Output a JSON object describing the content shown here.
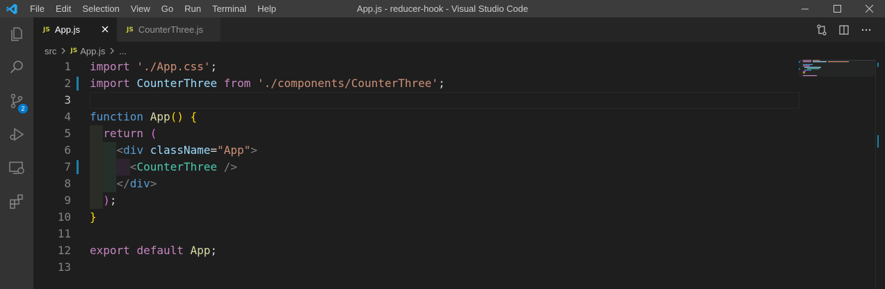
{
  "window": {
    "title": "App.js - reducer-hook - Visual Studio Code",
    "menu": [
      "File",
      "Edit",
      "Selection",
      "View",
      "Go",
      "Run",
      "Terminal",
      "Help"
    ]
  },
  "activity": {
    "scm_badge": "2"
  },
  "tabs": [
    {
      "label": "App.js",
      "icon": "JS",
      "active": true
    },
    {
      "label": "CounterThree.js",
      "icon": "JS",
      "active": false
    }
  ],
  "breadcrumb": {
    "folder": "src",
    "file_icon": "JS",
    "file": "App.js",
    "symbol": "..."
  },
  "editor": {
    "line_numbers": [
      "1",
      "2",
      "3",
      "4",
      "5",
      "6",
      "7",
      "8",
      "9",
      "10",
      "11",
      "12",
      "13"
    ],
    "lines": [
      {
        "t": [
          [
            "kw",
            "import"
          ],
          [
            "plain",
            " "
          ],
          [
            "str",
            "'./App.css'"
          ],
          [
            "plain",
            ";"
          ]
        ]
      },
      {
        "t": [
          [
            "kw",
            "import"
          ],
          [
            "plain",
            " "
          ],
          [
            "var",
            "CounterThree"
          ],
          [
            "plain",
            " "
          ],
          [
            "kw",
            "from"
          ],
          [
            "plain",
            " "
          ],
          [
            "str",
            "'./components/CounterThree'"
          ],
          [
            "plain",
            ";"
          ]
        ]
      },
      {
        "t": []
      },
      {
        "t": [
          [
            "kwb",
            "function"
          ],
          [
            "plain",
            " "
          ],
          [
            "fn",
            "App"
          ],
          [
            "par",
            "()"
          ],
          [
            "plain",
            " "
          ],
          [
            "par",
            "{"
          ]
        ]
      },
      {
        "t": [
          [
            "plain",
            "  "
          ],
          [
            "kw",
            "return"
          ],
          [
            "plain",
            " "
          ],
          [
            "par2",
            "("
          ]
        ]
      },
      {
        "t": [
          [
            "plain",
            "    "
          ],
          [
            "tagb",
            "<"
          ],
          [
            "tag",
            "div"
          ],
          [
            "plain",
            " "
          ],
          [
            "attr",
            "className"
          ],
          [
            "plain",
            "="
          ],
          [
            "str",
            "\"App\""
          ],
          [
            "tagb",
            ">"
          ]
        ]
      },
      {
        "t": [
          [
            "plain",
            "      "
          ],
          [
            "tagb",
            "<"
          ],
          [
            "cls",
            "CounterThree"
          ],
          [
            "plain",
            " "
          ],
          [
            "tagb",
            "/>"
          ]
        ]
      },
      {
        "t": [
          [
            "plain",
            "    "
          ],
          [
            "tagb",
            "</"
          ],
          [
            "tag",
            "div"
          ],
          [
            "tagb",
            ">"
          ]
        ]
      },
      {
        "t": [
          [
            "plain",
            "  "
          ],
          [
            "par2",
            ")"
          ],
          [
            "plain",
            ";"
          ]
        ]
      },
      {
        "t": [
          [
            "par",
            "}"
          ]
        ]
      },
      {
        "t": []
      },
      {
        "t": [
          [
            "kw",
            "export"
          ],
          [
            "plain",
            " "
          ],
          [
            "kw",
            "default"
          ],
          [
            "plain",
            " "
          ],
          [
            "fn",
            "App"
          ],
          [
            "plain",
            ";"
          ]
        ]
      },
      {
        "t": []
      }
    ]
  }
}
